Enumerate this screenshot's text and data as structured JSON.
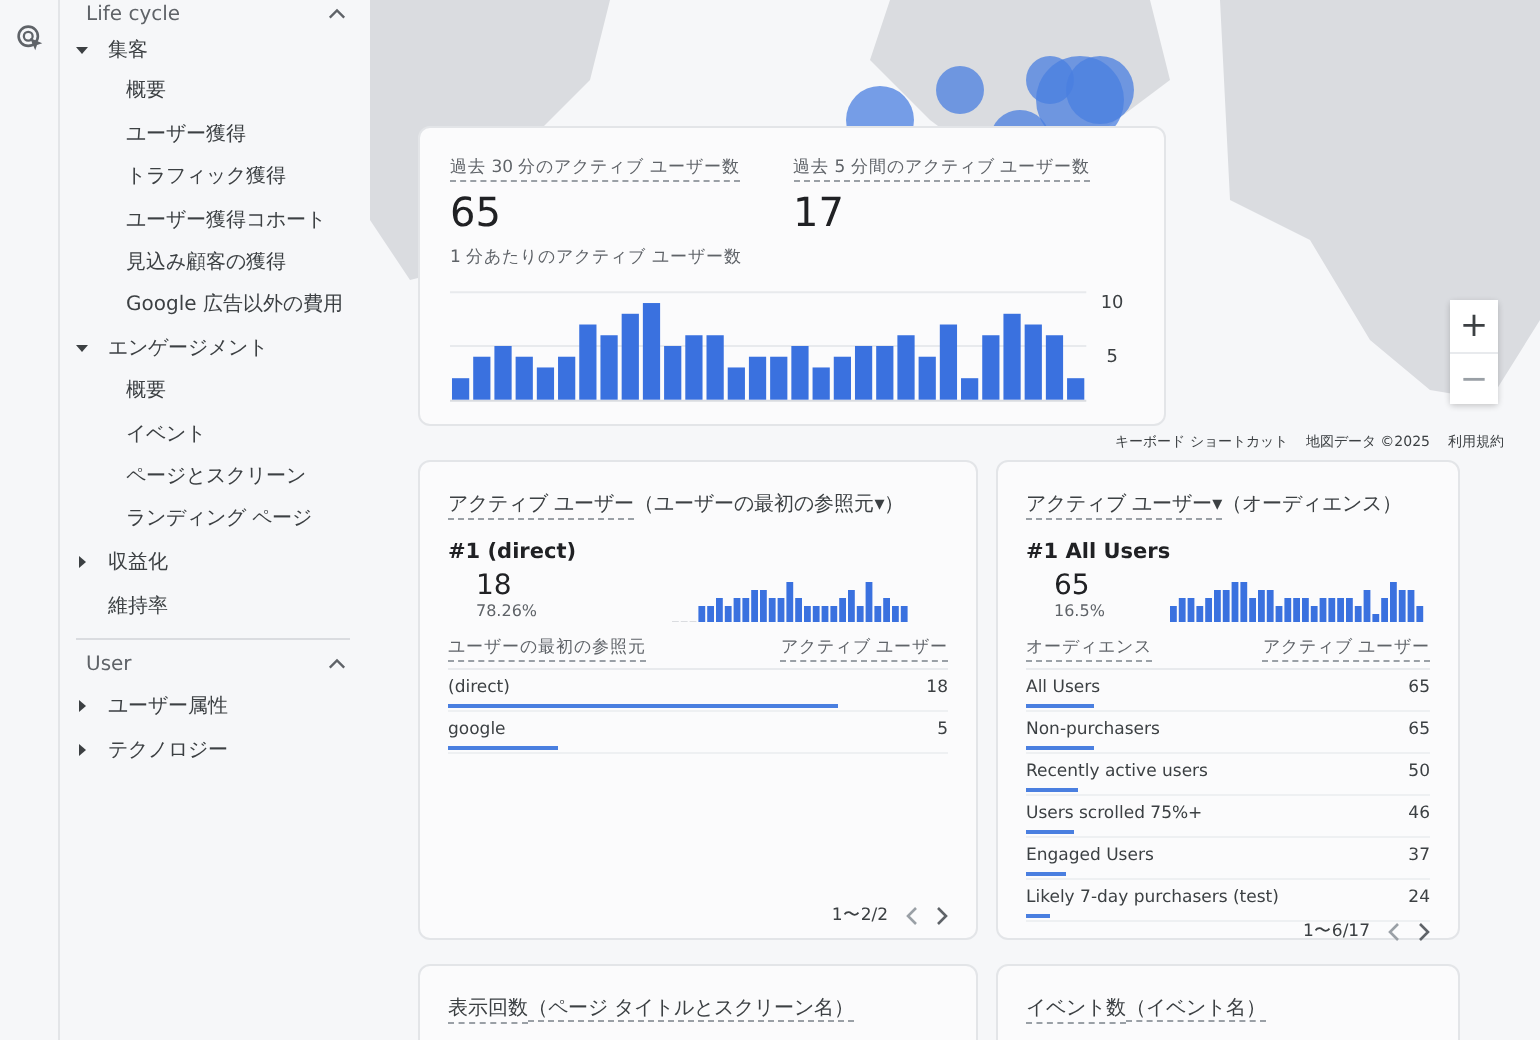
{
  "sidebar": {
    "section": {
      "title": "Life cycle",
      "expanded": true
    },
    "items": [
      {
        "label": "集客",
        "expanded": true,
        "children": [
          {
            "label": "概要"
          },
          {
            "label": "ユーザー獲得"
          },
          {
            "label": "トラフィック獲得"
          },
          {
            "label": "ユーザー獲得コホート"
          },
          {
            "label": "見込み顧客の獲得"
          },
          {
            "label": "Google 広告以外の費用"
          }
        ]
      },
      {
        "label": "エンゲージメント",
        "expanded": true,
        "children": [
          {
            "label": "概要"
          },
          {
            "label": "イベント"
          },
          {
            "label": "ページとスクリーン"
          },
          {
            "label": "ランディング ページ"
          }
        ]
      },
      {
        "label": "収益化",
        "expanded": false
      },
      {
        "label": "維持率"
      }
    ],
    "section2": {
      "title": "User",
      "expanded": true
    },
    "items2": [
      {
        "label": "ユーザー属性",
        "expanded": false
      },
      {
        "label": "テクノロジー",
        "expanded": false
      }
    ]
  },
  "map": {
    "attribution": [
      "キーボード ショートカット",
      "地図データ ©2025",
      "利用規約"
    ],
    "zoom_in": "+",
    "zoom_out": "−"
  },
  "realtime": {
    "metrics": [
      {
        "label": "過去 30 分のアクティブ ユーザー数",
        "value": "65"
      },
      {
        "label": "過去 5 分間のアクティブ ユーザー数",
        "value": "17"
      }
    ],
    "chart_title": "1 分あたりのアクティブ ユーザー数",
    "chart_data": {
      "type": "bar",
      "values": [
        2,
        4,
        5,
        4,
        3,
        4,
        7,
        6,
        8,
        9,
        5,
        6,
        6,
        3,
        4,
        4,
        5,
        3,
        4,
        5,
        5,
        6,
        4,
        7,
        2,
        6,
        8,
        7,
        6,
        2
      ],
      "yticks": [
        5,
        10
      ],
      "ylim": [
        0,
        10
      ]
    }
  },
  "cards": [
    {
      "title_metric": "アクティブ ユーザー",
      "title_dim": "（ユーザーの最初の参照元▾）",
      "top_label": "#1  (direct)",
      "top_value": "18",
      "top_share": "78.26%",
      "col_1": "ユーザーの最初の参照元",
      "col_2": "アクティブ ユーザー",
      "rows": [
        {
          "name": "(direct)",
          "value": "18",
          "level": 0.78
        },
        {
          "name": "google",
          "value": "5",
          "level": 0.22
        }
      ],
      "pager": "1〜2/2"
    },
    {
      "title_metric": "アクティブ ユーザー▾",
      "title_dim": "（オーディエンス）",
      "top_label": "#1  All Users",
      "top_value": "65",
      "top_share": "16.5%",
      "col_1": "オーディエンス",
      "col_2": "アクティブ ユーザー",
      "rows": [
        {
          "name": "All Users",
          "value": "65",
          "level": 0.17
        },
        {
          "name": "Non-purchasers",
          "value": "65",
          "level": 0.17
        },
        {
          "name": "Recently active users",
          "value": "50",
          "level": 0.13
        },
        {
          "name": "Users scrolled 75%+",
          "value": "46",
          "level": 0.12
        },
        {
          "name": "Engaged Users",
          "value": "37",
          "level": 0.1
        },
        {
          "name": "Likely 7-day purchasers (test)",
          "value": "24",
          "level": 0.06
        }
      ],
      "pager": "1〜6/17"
    }
  ],
  "bottom_cards": [
    {
      "metric": "表示回数",
      "dim": "（ページ タイトルとスクリーン名）"
    },
    {
      "metric": "イベント数",
      "dim": "（イベント名）"
    }
  ]
}
